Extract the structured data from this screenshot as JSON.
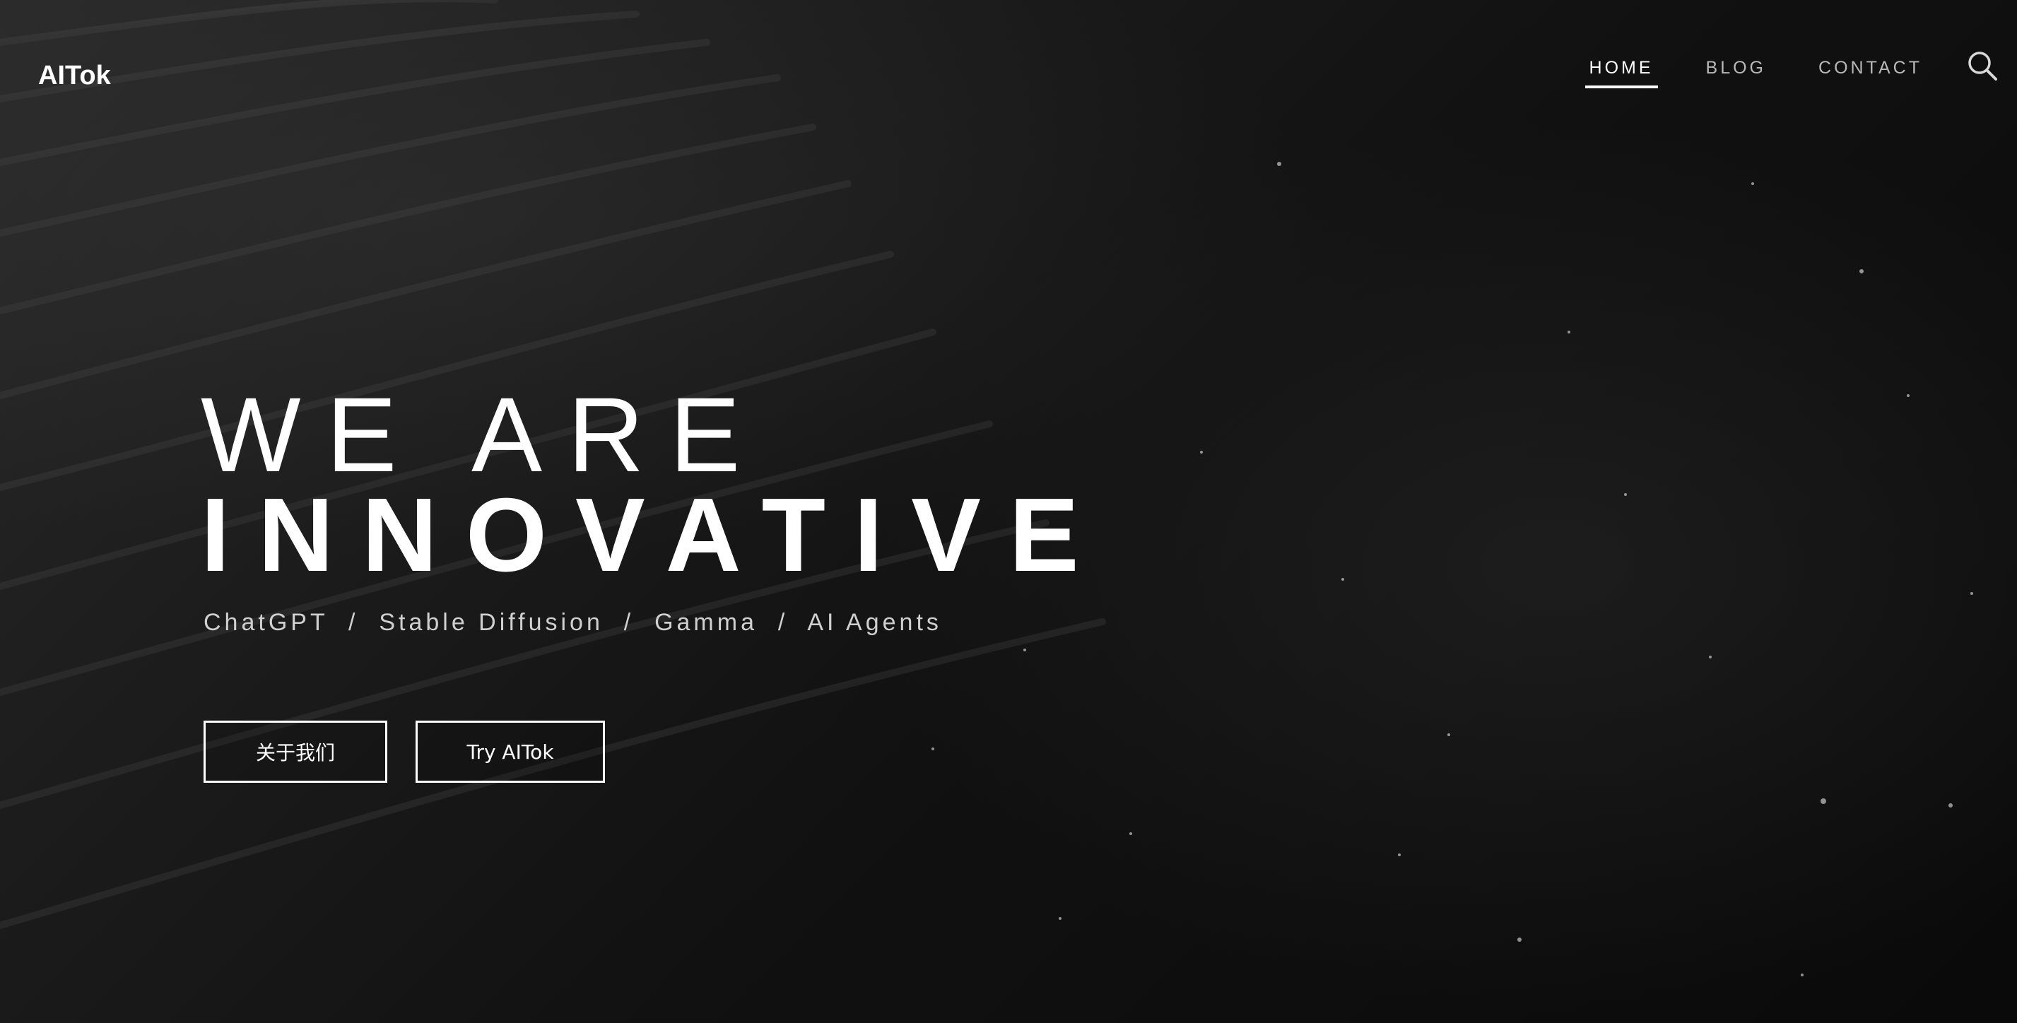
{
  "header": {
    "logo": "AITok",
    "nav": [
      {
        "label": "HOME",
        "active": true
      },
      {
        "label": "BLOG",
        "active": false
      },
      {
        "label": "CONTACT",
        "active": false
      }
    ],
    "search_icon": "search-icon"
  },
  "hero": {
    "line1": "WE ARE",
    "line2": "INNOVATIVE",
    "subtitle": "ChatGPT  /  Stable Diffusion  /  Gamma  /  AI Agents"
  },
  "buttons": {
    "about": "关于我们",
    "try": "Try AITok"
  },
  "colors": {
    "text": "#ffffff",
    "nav_inactive": "#b9b9b9",
    "background": "#0d0d0d"
  }
}
